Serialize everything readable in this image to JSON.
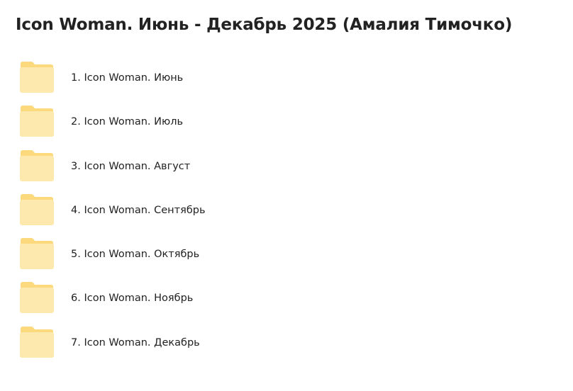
{
  "page": {
    "title": "Icon Woman. Июнь - Декабрь 2025 (Амалия Тимочко)"
  },
  "folders": [
    {
      "label": "1. Icon Woman. Июнь",
      "icon": "folder-icon"
    },
    {
      "label": "2. Icon Woman. Июль",
      "icon": "folder-icon"
    },
    {
      "label": "3. Icon Woman. Август",
      "icon": "folder-icon"
    },
    {
      "label": "4. Icon Woman. Сентябрь",
      "icon": "folder-icon"
    },
    {
      "label": "5. Icon Woman. Октябрь",
      "icon": "folder-icon"
    },
    {
      "label": "6. Icon Woman. Ноябрь",
      "icon": "folder-icon"
    },
    {
      "label": "7. Icon Woman. Декабрь",
      "icon": "folder-icon"
    }
  ],
  "colors": {
    "folder_back": "#fbd97c",
    "folder_front": "#fde9ad",
    "text": "#222222",
    "background": "#ffffff"
  }
}
